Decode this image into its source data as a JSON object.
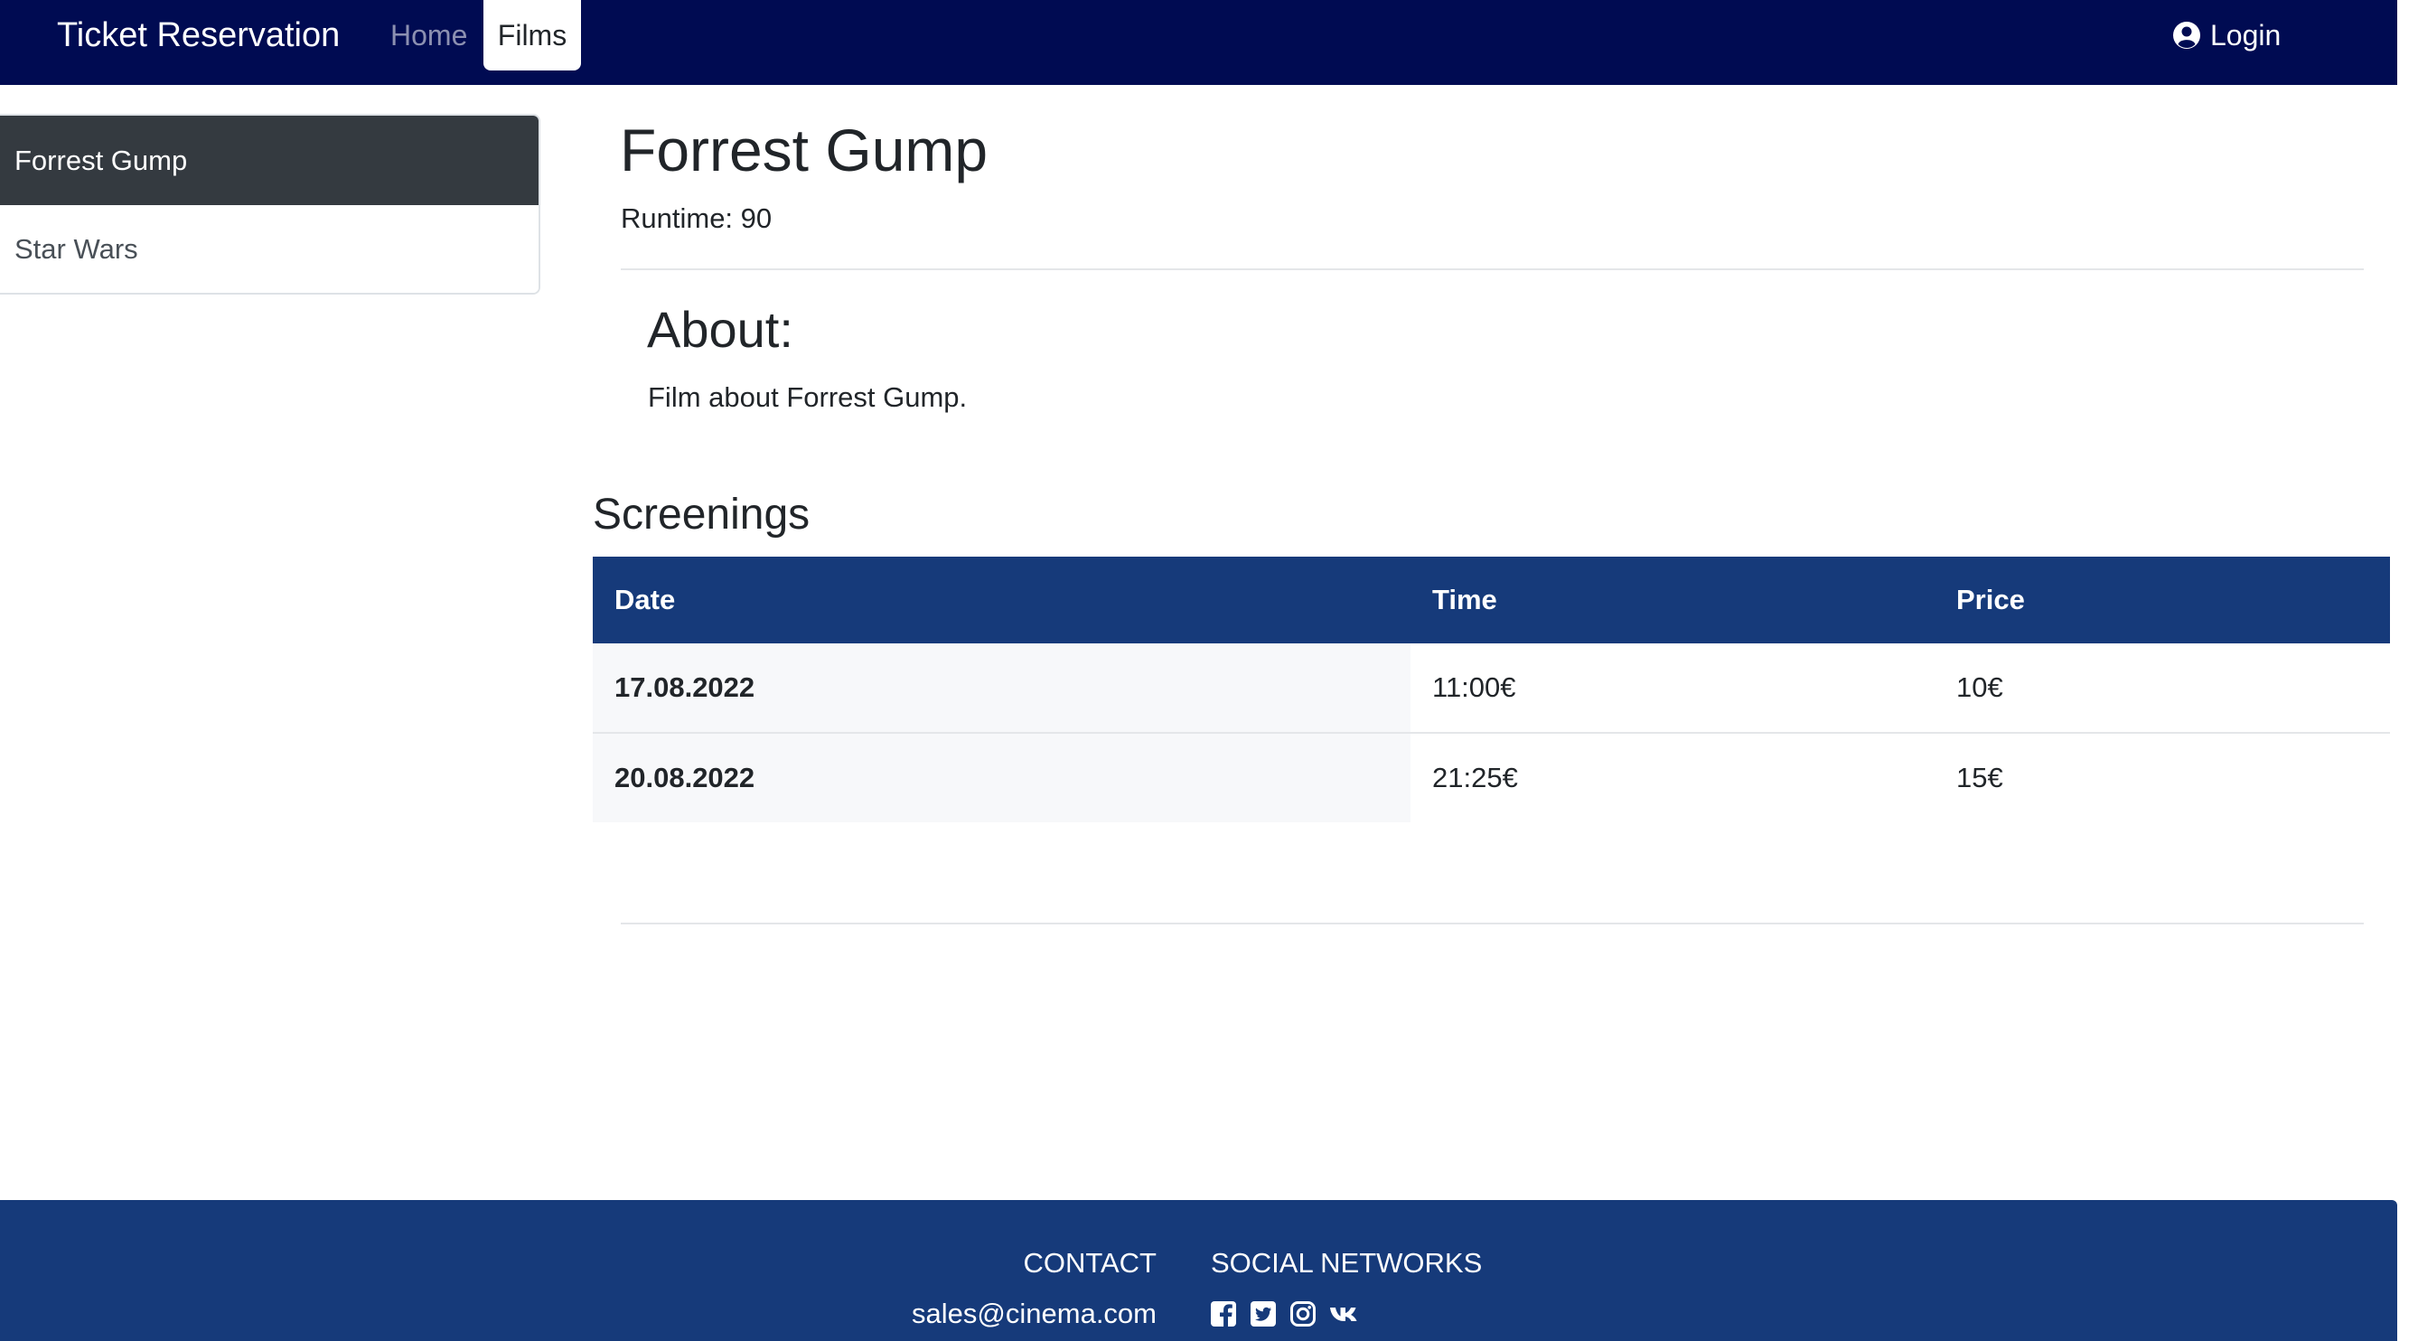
{
  "navbar": {
    "brand": "Ticket Reservation",
    "home": "Home",
    "films": "Films",
    "login": "Login"
  },
  "sidebar": {
    "items": [
      {
        "label": "Forrest Gump",
        "active": true
      },
      {
        "label": "Star Wars",
        "active": false
      }
    ]
  },
  "film": {
    "title": "Forrest Gump",
    "runtime": "Runtime: 90",
    "about_heading": "About:",
    "about_text": "Film about Forrest Gump."
  },
  "screenings": {
    "heading": "Screenings",
    "columns": [
      "Date",
      "Time",
      "Price"
    ],
    "rows": [
      {
        "date": "17.08.2022",
        "time": "11:00€",
        "price": "10€"
      },
      {
        "date": "20.08.2022",
        "time": "21:25€",
        "price": "15€"
      }
    ]
  },
  "footer": {
    "contact_heading": "CONTACT",
    "social_heading": "SOCIAL NETWORKS",
    "email": "sales@cinema.com",
    "icons": [
      "facebook-icon",
      "twitter-icon",
      "instagram-icon",
      "vk-icon"
    ]
  },
  "colors": {
    "navbar": "#000b52",
    "footer": "#163a7a",
    "table_header": "#163a7a",
    "sidebar_active": "#343a40"
  }
}
